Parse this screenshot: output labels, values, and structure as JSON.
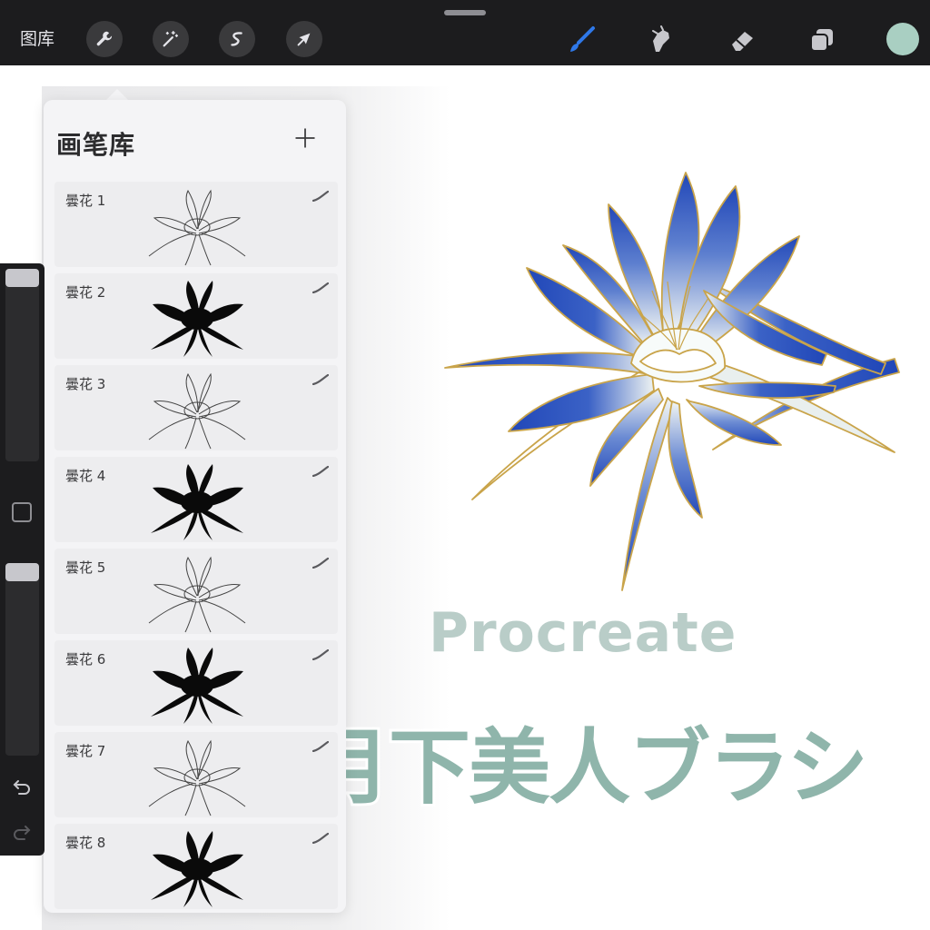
{
  "topbar": {
    "gallery_label": "图库",
    "tools_left": [
      {
        "name": "wrench-icon"
      },
      {
        "name": "magic-wand-icon"
      },
      {
        "name": "selection-icon"
      },
      {
        "name": "transform-arrow-icon"
      }
    ],
    "tools_right": [
      {
        "name": "brush-icon",
        "active": true
      },
      {
        "name": "smudge-icon"
      },
      {
        "name": "eraser-icon"
      },
      {
        "name": "layers-icon"
      }
    ],
    "current_color": "#a9cfc2"
  },
  "brush_library": {
    "title": "画笔库",
    "brushes": [
      {
        "name": "曇花 1",
        "style": "outline"
      },
      {
        "name": "曇花 2",
        "style": "solid"
      },
      {
        "name": "曇花 3",
        "style": "outline"
      },
      {
        "name": "曇花 4",
        "style": "solid"
      },
      {
        "name": "曇花 5",
        "style": "outline"
      },
      {
        "name": "曇花 6",
        "style": "solid"
      },
      {
        "name": "曇花 7",
        "style": "outline"
      },
      {
        "name": "曇花 8",
        "style": "solid"
      }
    ]
  },
  "canvas": {
    "watermark": "Procreate",
    "headline": "月下美人ブラシ"
  },
  "colors": {
    "accent_blue": "#2f78e8",
    "petal_blue": "#2147b8",
    "gold_outline": "#c9a44a",
    "watermark_text": "#b9cdc8",
    "headline_fill": "#8fb5ab"
  }
}
